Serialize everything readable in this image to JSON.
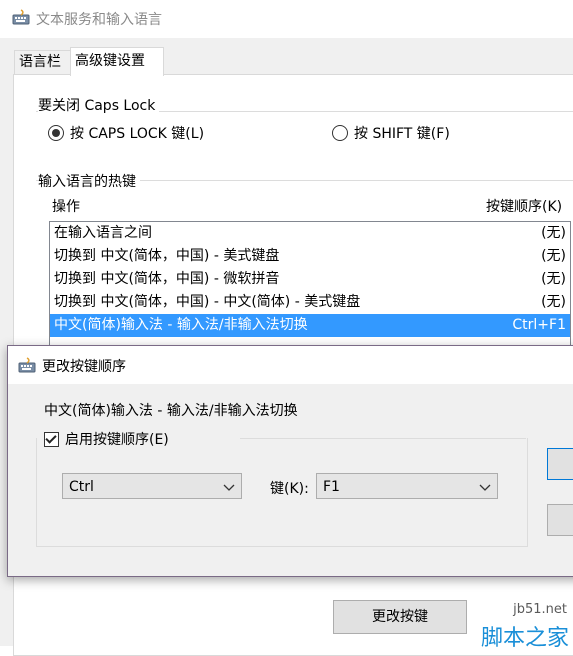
{
  "window": {
    "title": "文本服务和输入语言"
  },
  "tabs": [
    {
      "label": "语言栏",
      "active": false
    },
    {
      "label": "高级键设置",
      "active": true
    }
  ],
  "caps_lock": {
    "group_title": "要关闭 Caps Lock",
    "options": [
      {
        "label": "按 CAPS LOCK 键(L)",
        "checked": true
      },
      {
        "label": "按 SHIFT 键(F)",
        "checked": false
      }
    ]
  },
  "hotkeys": {
    "group_title": "输入语言的热键",
    "columns": {
      "action": "操作",
      "order": "按键顺序(K)"
    },
    "rows": [
      {
        "action": "在输入语言之间",
        "keys": "(无)",
        "selected": false
      },
      {
        "action": "切换到 中文(简体，中国) - 美式键盘",
        "keys": "(无)",
        "selected": false
      },
      {
        "action": "切换到 中文(简体，中国) - 微软拼音",
        "keys": "(无)",
        "selected": false
      },
      {
        "action": "切换到 中文(简体，中国) - 中文(简体) - 美式键盘",
        "keys": "(无)",
        "selected": false
      },
      {
        "action": "中文(简体)输入法 - 输入法/非输入法切换",
        "keys": "Ctrl+F1",
        "selected": true
      }
    ],
    "change_button": "更改按键"
  },
  "dialog": {
    "title": "更改按键顺序",
    "description": "中文(简体)输入法 - 输入法/非输入法切换",
    "enable_checkbox": {
      "label": "启用按键顺序(E)",
      "checked": true
    },
    "modifier_value": "Ctrl",
    "key_label": "键(K):",
    "key_value": "F1"
  },
  "watermark": {
    "site": "jb51.net",
    "name": "脚本之家"
  },
  "colors": {
    "selection": "#3399ff",
    "accent": "#0078d7",
    "watermark": "#1a8fd8"
  }
}
